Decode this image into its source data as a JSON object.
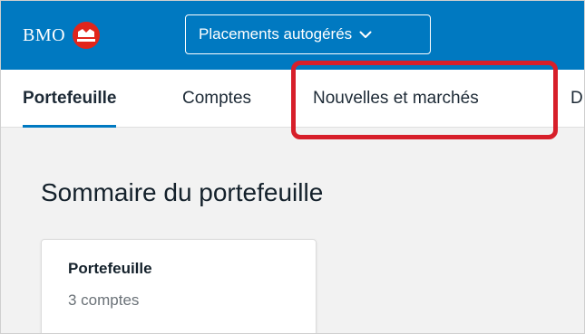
{
  "header": {
    "brand": "BMO",
    "logo_icon": "bmo-roundel-icon",
    "product_select": {
      "label": "Placements autogérés",
      "icon": "chevron-down-icon"
    },
    "bar_color": "#0079c1",
    "logo_color": "#e1251b"
  },
  "nav": {
    "tabs": [
      {
        "label": "Portefeuille",
        "active": true
      },
      {
        "label": "Comptes",
        "active": false
      },
      {
        "label": "Nouvelles et marchés",
        "active": false,
        "highlighted": true
      },
      {
        "label": "D",
        "active": false
      }
    ],
    "highlight_color": "#d71f2a"
  },
  "main": {
    "title": "Sommaire du portefeuille",
    "card": {
      "title": "Portefeuille",
      "subtitle": "3 comptes"
    }
  }
}
